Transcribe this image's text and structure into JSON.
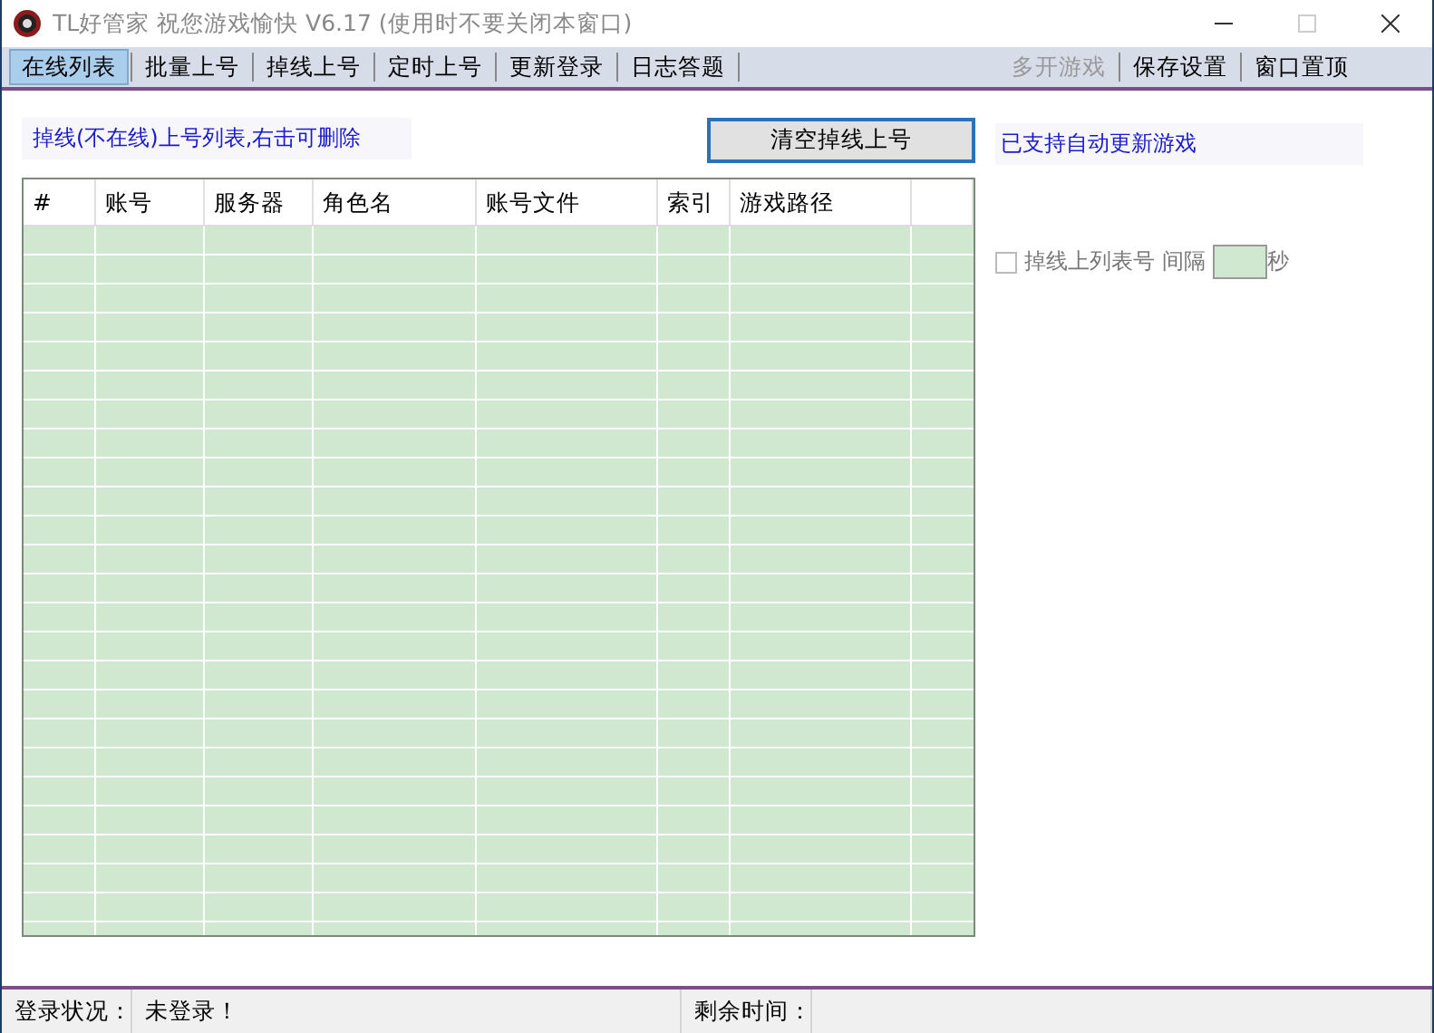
{
  "window": {
    "title": "TL好管家 祝您游戏愉快 V6.17 (使用时不要关闭本窗口)"
  },
  "tabs": [
    {
      "label": "在线列表",
      "selected": true
    },
    {
      "label": "批量上号",
      "selected": false
    },
    {
      "label": "掉线上号",
      "selected": false
    },
    {
      "label": "定时上号",
      "selected": false
    },
    {
      "label": "更新登录",
      "selected": false
    },
    {
      "label": "日志答题",
      "selected": false
    }
  ],
  "toolbar_buttons": [
    {
      "label": "多开游戏",
      "disabled": true
    },
    {
      "label": "保存设置",
      "disabled": false
    },
    {
      "label": "窗口置顶",
      "disabled": false
    }
  ],
  "list_caption": "掉线(不在线)上号列表,右击可删除",
  "clear_button": "清空掉线上号",
  "notice": "已支持自动更新游戏",
  "table": {
    "columns": [
      "#",
      "账号",
      "服务器",
      "角色名",
      "账号文件",
      "索引",
      "游戏路径",
      ""
    ]
  },
  "auto_relogin": {
    "label": "掉线上列表号",
    "checked": false,
    "disabled": true,
    "interval_label": "间隔",
    "unit": "秒"
  },
  "status_bar": {
    "cells": [
      "登录状况：",
      "未登录！",
      "剩余时间：",
      ""
    ]
  }
}
